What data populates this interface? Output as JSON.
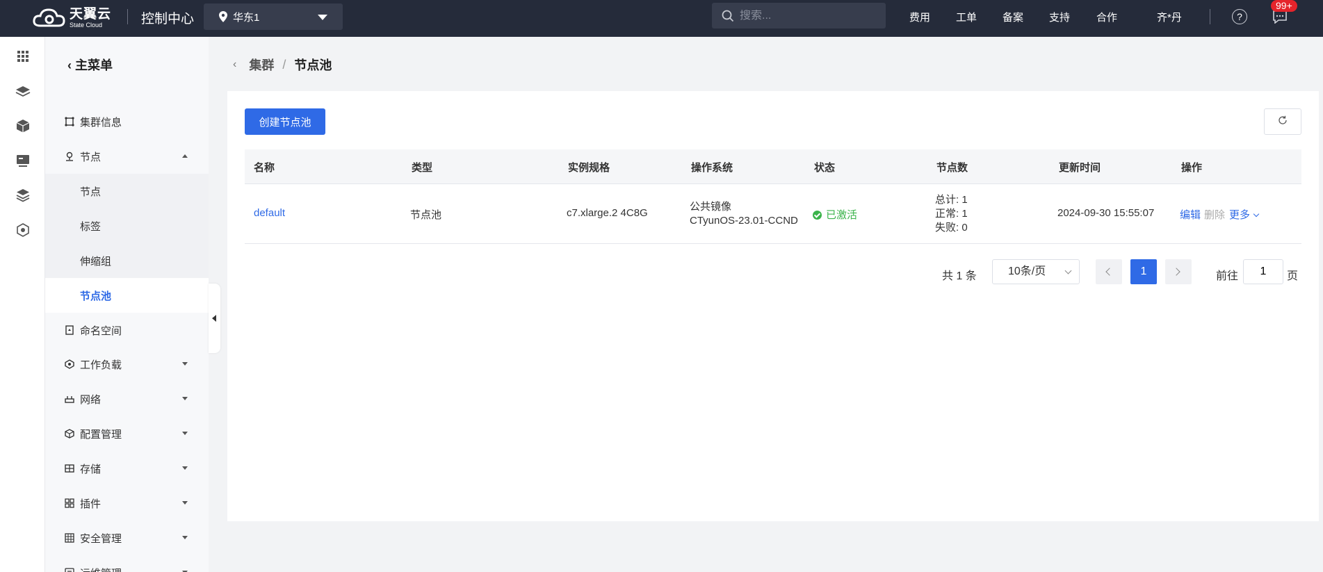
{
  "header": {
    "logo_main": "天翼云",
    "logo_sub": "State Cloud",
    "console_title": "控制中心",
    "region": "华东1",
    "search_placeholder": "搜索...",
    "nav": [
      "费用",
      "工单",
      "备案",
      "支持",
      "合作"
    ],
    "user": "齐*丹",
    "badge": "99+"
  },
  "sidebar": {
    "title": "主菜单",
    "items": [
      {
        "label": "集群信息"
      },
      {
        "label": "节点",
        "expanded": true
      },
      {
        "label": "命名空间"
      },
      {
        "label": "工作负载"
      },
      {
        "label": "网络"
      },
      {
        "label": "配置管理"
      },
      {
        "label": "存储"
      },
      {
        "label": "插件"
      },
      {
        "label": "安全管理"
      },
      {
        "label": "运维管理"
      }
    ],
    "subitems": [
      {
        "label": "节点"
      },
      {
        "label": "标签"
      },
      {
        "label": "伸缩组"
      },
      {
        "label": "节点池",
        "active": true
      }
    ]
  },
  "breadcrumb": {
    "parent": "集群",
    "separator": "/",
    "current": "节点池"
  },
  "toolbar": {
    "create_label": "创建节点池",
    "refresh_icon": "refresh-icon"
  },
  "table": {
    "columns": [
      "名称",
      "类型",
      "实例规格",
      "操作系统",
      "状态",
      "节点数",
      "更新时间",
      "操作"
    ],
    "rows": [
      {
        "name": "default",
        "type": "节点池",
        "spec": "c7.xlarge.2 4C8G",
        "os_line1": "公共镜像",
        "os_line2": "CTyunOS-23.01-CCND",
        "status": "已激活",
        "nodes_total": "总计: 1",
        "nodes_normal": "正常: 1",
        "nodes_failed": "失败: 0",
        "updated": "2024-09-30 15:55:07",
        "actions": {
          "edit": "编辑",
          "delete": "删除",
          "more": "更多"
        }
      }
    ]
  },
  "pagination": {
    "total": "共 1 条",
    "page_size": "10条/页",
    "current_page": "1",
    "goto_label": "前往",
    "goto_value": "1",
    "page_suffix": "页"
  },
  "colors": {
    "topbar": "#252b3a",
    "accent": "#2f6ae6",
    "success": "#3ab34a",
    "badge": "#e5242b"
  }
}
